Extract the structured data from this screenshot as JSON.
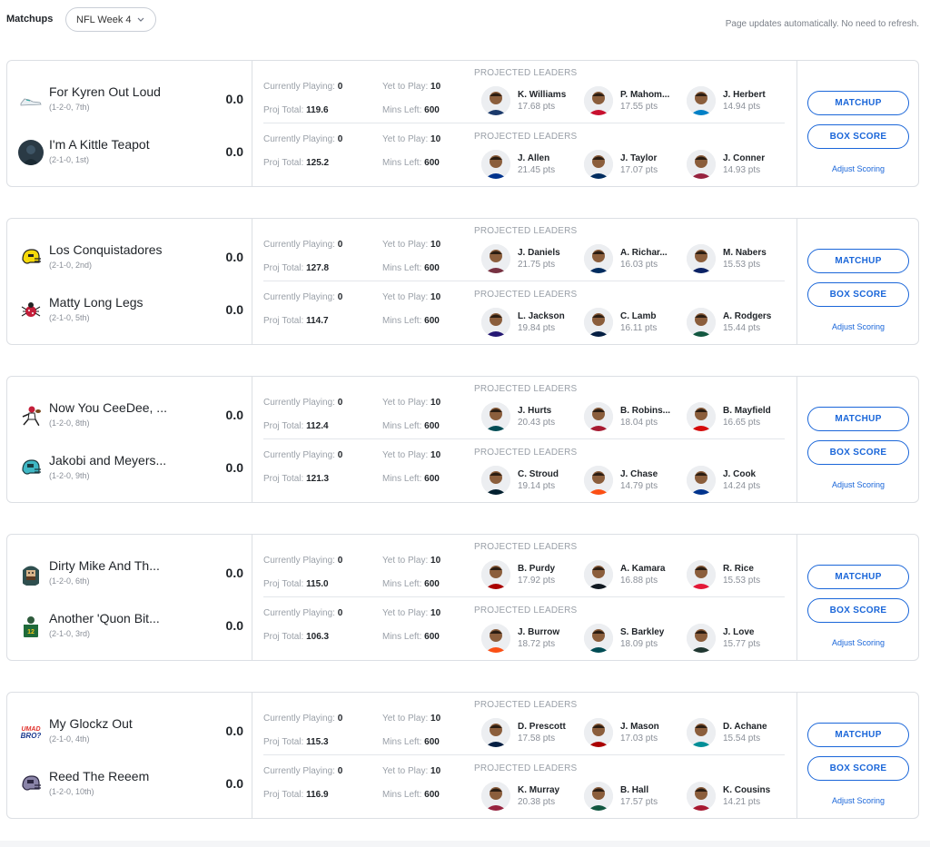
{
  "header": {
    "title": "Matchups",
    "week_select": "NFL Week 4",
    "notice": "Page updates automatically. No need to refresh."
  },
  "labels": {
    "currently_playing": "Currently Playing:",
    "yet_to_play": "Yet to Play:",
    "proj_total": "Proj Total:",
    "mins_left": "Mins Left:",
    "projected_leaders": "PROJECTED LEADERS",
    "matchup_button": "MATCHUP",
    "box_score_button": "BOX SCORE",
    "adjust_scoring": "Adjust Scoring"
  },
  "colors": {
    "accent": "#1a66d9"
  },
  "matchups": [
    {
      "teams": [
        {
          "name": "For Kyren Out Loud",
          "record": "(1-2-0, 7th)",
          "score": "0.0",
          "logo": "sneaker-icon",
          "currently_playing": "0",
          "yet_to_play": "10",
          "proj_total": "119.6",
          "mins_left": "600",
          "leaders": [
            {
              "name": "K. Williams",
              "pts": "17.68 pts",
              "jersey": "#1b3a6b"
            },
            {
              "name": "P. Mahom...",
              "pts": "17.55 pts",
              "jersey": "#c8102e"
            },
            {
              "name": "J. Herbert",
              "pts": "14.94 pts",
              "jersey": "#0080c6"
            }
          ]
        },
        {
          "name": "I'm A Kittle Teapot",
          "record": "(2-1-0, 1st)",
          "score": "0.0",
          "logo": "photo-avatar-icon",
          "currently_playing": "0",
          "yet_to_play": "10",
          "proj_total": "125.2",
          "mins_left": "600",
          "leaders": [
            {
              "name": "J. Allen",
              "pts": "21.45 pts",
              "jersey": "#00338d"
            },
            {
              "name": "J. Taylor",
              "pts": "17.07 pts",
              "jersey": "#002c5f"
            },
            {
              "name": "J. Conner",
              "pts": "14.93 pts",
              "jersey": "#97233f"
            }
          ]
        }
      ]
    },
    {
      "teams": [
        {
          "name": "Los Conquistadores",
          "record": "(2-1-0, 2nd)",
          "score": "0.0",
          "logo": "helmet-yellow-icon",
          "currently_playing": "0",
          "yet_to_play": "10",
          "proj_total": "127.8",
          "mins_left": "600",
          "leaders": [
            {
              "name": "J. Daniels",
              "pts": "21.75 pts",
              "jersey": "#773141"
            },
            {
              "name": "A. Richar...",
              "pts": "16.03 pts",
              "jersey": "#002c5f"
            },
            {
              "name": "M. Nabers",
              "pts": "15.53 pts",
              "jersey": "#0b2265"
            }
          ]
        },
        {
          "name": "Matty Long Legs",
          "record": "(2-1-0, 5th)",
          "score": "0.0",
          "logo": "bug-icon",
          "currently_playing": "0",
          "yet_to_play": "10",
          "proj_total": "114.7",
          "mins_left": "600",
          "leaders": [
            {
              "name": "L. Jackson",
              "pts": "19.84 pts",
              "jersey": "#241773"
            },
            {
              "name": "C. Lamb",
              "pts": "16.11 pts",
              "jersey": "#041e42"
            },
            {
              "name": "A. Rodgers",
              "pts": "15.44 pts",
              "jersey": "#125740"
            }
          ]
        }
      ]
    },
    {
      "teams": [
        {
          "name": "Now You CeeDee, ...",
          "record": "(1-2-0, 8th)",
          "score": "0.0",
          "logo": "football-player-icon",
          "currently_playing": "0",
          "yet_to_play": "10",
          "proj_total": "112.4",
          "mins_left": "600",
          "leaders": [
            {
              "name": "J. Hurts",
              "pts": "20.43 pts",
              "jersey": "#004c54"
            },
            {
              "name": "B. Robins...",
              "pts": "18.04 pts",
              "jersey": "#a71930"
            },
            {
              "name": "B. Mayfield",
              "pts": "16.65 pts",
              "jersey": "#d50a0a"
            }
          ]
        },
        {
          "name": "Jakobi and Meyers...",
          "record": "(1-2-0, 9th)",
          "score": "0.0",
          "logo": "helmet-teal-icon",
          "currently_playing": "0",
          "yet_to_play": "10",
          "proj_total": "121.3",
          "mins_left": "600",
          "leaders": [
            {
              "name": "C. Stroud",
              "pts": "19.14 pts",
              "jersey": "#03202f"
            },
            {
              "name": "J. Chase",
              "pts": "14.79 pts",
              "jersey": "#fb4f14"
            },
            {
              "name": "J. Cook",
              "pts": "14.24 pts",
              "jersey": "#00338d"
            }
          ]
        }
      ]
    },
    {
      "teams": [
        {
          "name": "Dirty Mike And Th...",
          "record": "(1-2-0, 6th)",
          "score": "0.0",
          "logo": "hood-character-icon",
          "currently_playing": "0",
          "yet_to_play": "10",
          "proj_total": "115.0",
          "mins_left": "600",
          "leaders": [
            {
              "name": "B. Purdy",
              "pts": "17.92 pts",
              "jersey": "#aa0000"
            },
            {
              "name": "A. Kamara",
              "pts": "16.88 pts",
              "jersey": "#101820"
            },
            {
              "name": "R. Rice",
              "pts": "15.53 pts",
              "jersey": "#e31837"
            }
          ]
        },
        {
          "name": "Another 'Quon Bit...",
          "record": "(2-1-0, 3rd)",
          "score": "0.0",
          "logo": "jersey-green-icon",
          "currently_playing": "0",
          "yet_to_play": "10",
          "proj_total": "106.3",
          "mins_left": "600",
          "leaders": [
            {
              "name": "J. Burrow",
              "pts": "18.72 pts",
              "jersey": "#fb4f14"
            },
            {
              "name": "S. Barkley",
              "pts": "18.09 pts",
              "jersey": "#004c54"
            },
            {
              "name": "J. Love",
              "pts": "15.77 pts",
              "jersey": "#203731"
            }
          ]
        }
      ]
    },
    {
      "teams": [
        {
          "name": "My Glockz Out",
          "record": "(2-1-0, 4th)",
          "score": "0.0",
          "logo": "umad-bro-icon",
          "currently_playing": "0",
          "yet_to_play": "10",
          "proj_total": "115.3",
          "mins_left": "600",
          "leaders": [
            {
              "name": "D. Prescott",
              "pts": "17.58 pts",
              "jersey": "#041e42"
            },
            {
              "name": "J. Mason",
              "pts": "17.03 pts",
              "jersey": "#aa0000"
            },
            {
              "name": "D. Achane",
              "pts": "15.54 pts",
              "jersey": "#008e97"
            }
          ]
        },
        {
          "name": "Reed The Reeem",
          "record": "(1-2-0, 10th)",
          "score": "0.0",
          "logo": "helmet-purple-icon",
          "currently_playing": "0",
          "yet_to_play": "10",
          "proj_total": "116.9",
          "mins_left": "600",
          "leaders": [
            {
              "name": "K. Murray",
              "pts": "20.38 pts",
              "jersey": "#97233f"
            },
            {
              "name": "B. Hall",
              "pts": "17.57 pts",
              "jersey": "#125740"
            },
            {
              "name": "K. Cousins",
              "pts": "14.21 pts",
              "jersey": "#a71930"
            }
          ]
        }
      ]
    }
  ]
}
